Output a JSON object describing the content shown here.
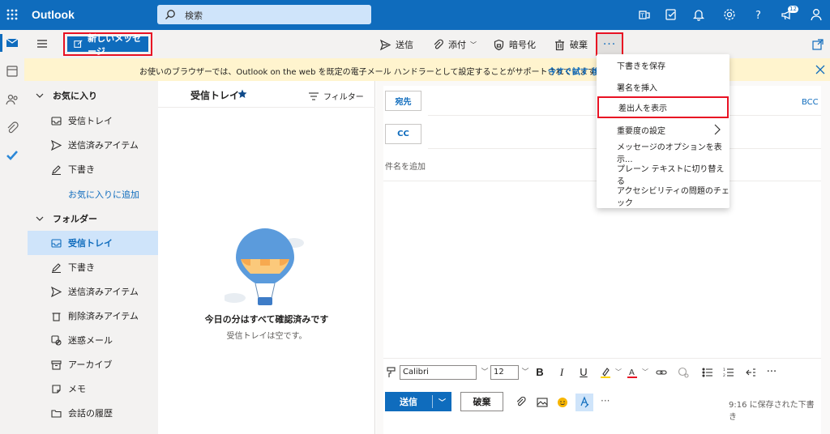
{
  "topbar": {
    "app_name": "Outlook",
    "search_placeholder": "検索",
    "notification_count": "12",
    "icons": [
      "waffle-icon",
      "teams-icon",
      "todo-icon",
      "bell-icon",
      "gear-icon",
      "help-icon",
      "megaphone-icon",
      "account-icon"
    ]
  },
  "ribbon": {
    "new_message": "新しいメッセージ",
    "send": "送信",
    "attach": "添付",
    "encrypt": "暗号化",
    "discard": "破棄",
    "more": "···"
  },
  "banner": {
    "message": "お使いのブラウザーでは、Outlook on the web を既定の電子メール ハンドラーとして設定することがサポートされています。",
    "try_now": "今すぐ試す",
    "truncated": "後"
  },
  "folders": {
    "favorites_header": "お気に入り",
    "favorites": [
      "受信トレイ",
      "送信済みアイテム",
      "下書き"
    ],
    "add_favorite": "お気に入りに追加",
    "folders_header": "フォルダー",
    "items": [
      "受信トレイ",
      "下書き",
      "送信済みアイテム",
      "削除済みアイテム",
      "迷惑メール",
      "アーカイブ",
      "メモ",
      "会話の履歴"
    ]
  },
  "message_list": {
    "title": "受信トレイ",
    "filter": "フィルター",
    "empty_title": "今日の分はすべて確認済みです",
    "empty_subtitle": "受信トレイは空です。"
  },
  "compose": {
    "to": "宛先",
    "cc": "CC",
    "bcc": "BCC",
    "subject_placeholder": "件名を追加",
    "font": "Calibri",
    "font_size": "12",
    "send": "送信",
    "discard": "破棄",
    "saved_status": "9:16 に保存された下書き",
    "more": "···"
  },
  "more_menu": {
    "items": [
      "下書きを保存",
      "署名を挿入",
      "差出人を表示",
      "重要度の設定",
      "メッセージのオプションを表示...",
      "プレーン テキストに切り替える",
      "アクセシビリティの問題のチェック"
    ]
  },
  "colors": {
    "brand": "#0f6cbd",
    "highlight_border": "#e81123",
    "banner": "#fff4ce"
  }
}
